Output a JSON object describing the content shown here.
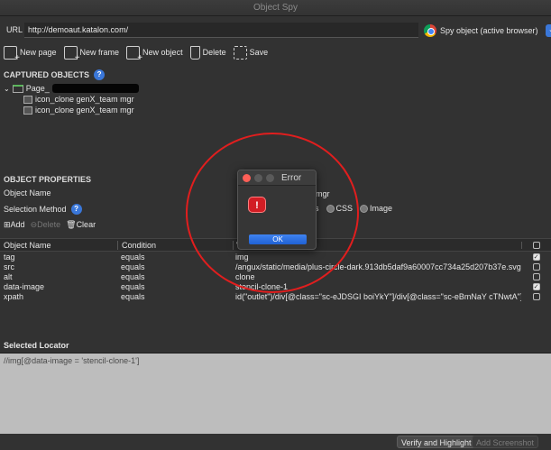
{
  "window": {
    "title": "Object Spy"
  },
  "url_bar": {
    "label": "URL",
    "value": "http://demoaut.katalon.com/"
  },
  "spy_button": {
    "label": "Spy object (active browser)",
    "browser_icon": "chrome-icon",
    "chevron": "⌄"
  },
  "toolbar": {
    "new_page": "New page",
    "new_frame": "New frame",
    "new_object": "New object",
    "delete": "Delete",
    "save": "Save"
  },
  "captured_objects": {
    "title": "CAPTURED OBJECTS",
    "help": "?",
    "root_label": "Page_",
    "items": [
      "icon_clone genX_team mgr",
      "icon_clone genX_team mgr"
    ]
  },
  "object_properties": {
    "title": "OBJECT PROPERTIES",
    "object_name_label": "Object Name",
    "object_name_value_partial": "m mgr",
    "selection_method_label": "Selection Method",
    "help": "?",
    "options": [
      "es",
      "CSS",
      "Image"
    ],
    "add": "Add",
    "delete": "Delete",
    "clear": "Clear"
  },
  "table": {
    "headers": [
      "Object Name",
      "Condition",
      "V"
    ],
    "rows": [
      {
        "name": "tag",
        "condition": "equals",
        "value": "img",
        "checked": true
      },
      {
        "name": "src",
        "condition": "equals",
        "value": "/angux/static/media/plus-circle-dark.913db5daf9a60007cc734a25d207b37e.svg",
        "checked": false
      },
      {
        "name": "alt",
        "condition": "equals",
        "value": "clone",
        "checked": false
      },
      {
        "name": "data-image",
        "condition": "equals",
        "value": "stencil-clone-1",
        "checked": true
      },
      {
        "name": "xpath",
        "condition": "equals",
        "value": "id(\"outlet\")/div[@class=\"sc-eJDSGI boiYkY\"]/div[@class=\"sc-eBmNaY cTNwtA\"]/div[",
        "checked": false
      }
    ]
  },
  "selected_locator": {
    "title": "Selected Locator",
    "value": "//img[@data-image = 'stencil-clone-1']"
  },
  "bottom_buttons": {
    "verify": "Verify and Highlight",
    "screenshot": "Add Screenshot"
  },
  "error_dialog": {
    "title": "Error",
    "icon": "!",
    "ok": "OK"
  }
}
